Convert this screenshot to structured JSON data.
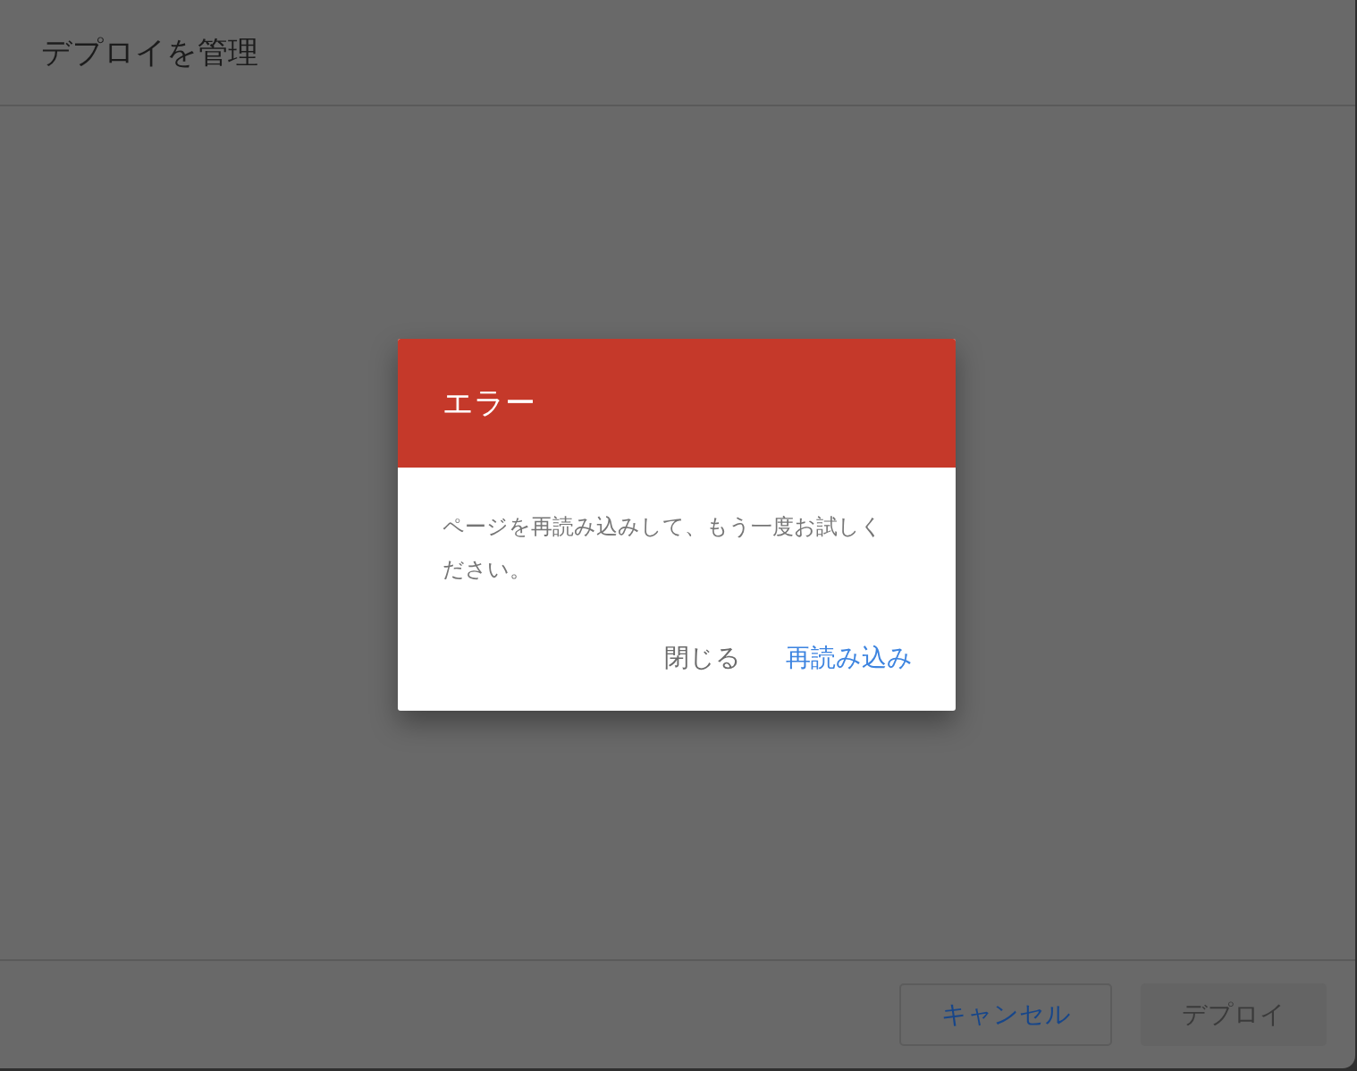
{
  "window": {
    "title": "デプロイを管理"
  },
  "footer": {
    "buttons": [
      {
        "label": "キャンセル",
        "kind": "outlined",
        "disabled": false
      },
      {
        "label": "デプロイ",
        "kind": "filled",
        "disabled": true
      }
    ]
  },
  "dialog": {
    "title": "エラー",
    "message": "ページを再読み込みして、もう一度お試しください。",
    "buttons": [
      {
        "label": "閉じる",
        "kind": "secondary"
      },
      {
        "label": "再読み込み",
        "kind": "primary"
      }
    ]
  }
}
